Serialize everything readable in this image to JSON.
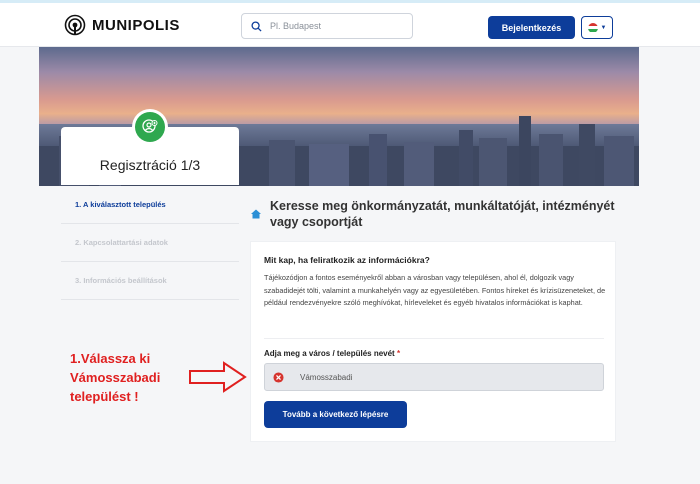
{
  "header": {
    "logo_text": "MUNIPOLIS",
    "search_placeholder": "Pl. Budapest",
    "login_label": "Bejelentkezés",
    "flag_colors": [
      "#d6342e",
      "#ffffff",
      "#2fa84f"
    ]
  },
  "registration": {
    "title": "Regisztráció 1/3",
    "steps": [
      {
        "label": "1. A kiválasztott település",
        "active": true
      },
      {
        "label": "2. Kapcsolattartási adatok",
        "active": false
      },
      {
        "label": "3. Információs beállítások",
        "active": false
      }
    ]
  },
  "main": {
    "title": "Keresse meg önkormányzatát, munkáltatóját, intézményét vagy csoportját",
    "info_heading": "Mit kap, ha feliratkozik az információkra?",
    "info_text": "Tájékozódjon a fontos eseményekről abban a városban vagy településen, ahol él, dolgozik vagy szabadidejét tölti, valamint a munkahelyén vagy az egyesületében. Fontos híreket és krízisüzeneteket, de például rendezvényekre szóló meghívókat, hírleveleket és egyéb hivatalos információkat is kaphat.",
    "field_label": "Adja meg a város / település nevét",
    "required_mark": "*",
    "field_value": "Vámosszabadi",
    "next_button": "Tovább a következő lépésre"
  },
  "annotation": {
    "text": "1.Válassza ki Vámosszabadi települést !",
    "color": "#e02020"
  },
  "colors": {
    "primary": "#0d3d9a",
    "accent_green": "#2fa84f"
  }
}
